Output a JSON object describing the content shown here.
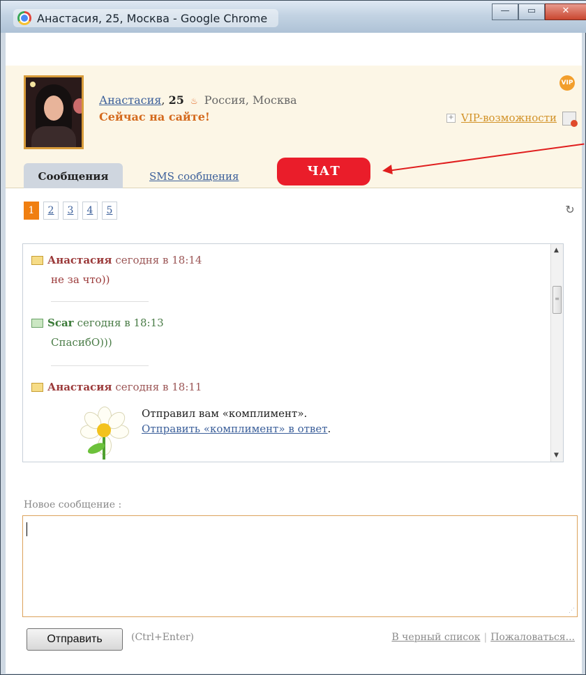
{
  "window": {
    "title": "Анастасия, 25, Москва - Google Chrome",
    "controls": {
      "minimize": "—",
      "maximize": "▭",
      "close": "✕"
    }
  },
  "profile": {
    "name": "Анастасия",
    "age": "25",
    "location": "Россия, Москва",
    "online_status": "Сейчас на сайте!",
    "vip_link": "VIP-возможности",
    "vip_badge": "VIP",
    "plus": "+"
  },
  "tabs": {
    "messages": "Сообщения",
    "sms": "SMS сообщения",
    "chat": "ЧАТ"
  },
  "pagination": {
    "pages": [
      "1",
      "2",
      "3",
      "4",
      "5"
    ],
    "active": "1"
  },
  "messages": [
    {
      "author": "Анастасия",
      "time": "сегодня в 18:14",
      "text": "не за что))"
    },
    {
      "author": "Scar",
      "time": "сегодня в 18:13",
      "text": "СпасибО)))"
    },
    {
      "author": "Анастасия",
      "time": "сегодня в 18:11",
      "gift_text": "Отправил вам «комплимент».",
      "gift_link": "Отправить «комплимент» в ответ",
      "gift_link_end": "."
    }
  ],
  "compose": {
    "label": "Новое сообщение :",
    "value": "",
    "send_button": "Отправить",
    "shortcut_hint": "(Ctrl+Enter)"
  },
  "footer": {
    "blacklist": "В черный список",
    "separator": "|",
    "report": "Пожаловаться..."
  },
  "colors": {
    "accent_orange": "#f07f11",
    "chat_red": "#ea1d2a",
    "link_blue": "#3b5f9a",
    "incoming_author": "#9b3a3a",
    "outgoing_author": "#3b7a38"
  }
}
